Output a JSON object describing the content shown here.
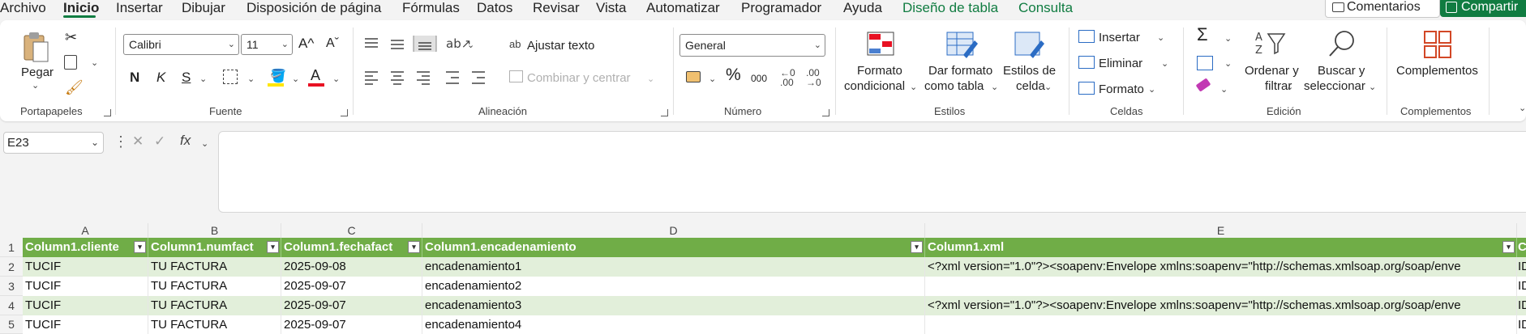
{
  "menu": {
    "items": [
      "Archivo",
      "Inicio",
      "Insertar",
      "Dibujar",
      "Disposición de página",
      "Fórmulas",
      "Datos",
      "Revisar",
      "Vista",
      "Automatizar",
      "Programador",
      "Ayuda",
      "Diseño de tabla",
      "Consulta"
    ],
    "active": "Inicio",
    "comments": "Comentarios",
    "share": "Compartir"
  },
  "ribbon": {
    "portapapeles": {
      "paste": "Pegar",
      "label": "Portapapeles"
    },
    "fuente": {
      "font": "Calibri",
      "size": "11",
      "bold": "N",
      "italic": "K",
      "underline": "S",
      "label": "Fuente"
    },
    "alineacion": {
      "wrap": "Ajustar texto",
      "merge": "Combinar y centrar",
      "label": "Alineación"
    },
    "numero": {
      "format": "General",
      "percent": "%",
      "thousands": "000",
      "label": "Número"
    },
    "estilos": {
      "conditional_1": "Formato",
      "conditional_2": "condicional",
      "astable_1": "Dar formato",
      "astable_2": "como tabla",
      "cellstyles_1": "Estilos de",
      "cellstyles_2": "celda",
      "label": "Estilos"
    },
    "celdas": {
      "insert": "Insertar",
      "delete": "Eliminar",
      "format": "Formato",
      "label": "Celdas"
    },
    "edicion": {
      "sort_1": "Ordenar y",
      "sort_2": "filtrar",
      "find_1": "Buscar y",
      "find_2": "seleccionar",
      "label": "Edición"
    },
    "complementos": {
      "button": "Complementos",
      "label": "Complementos"
    }
  },
  "formula_bar": {
    "name_box": "E23",
    "fx": "fx",
    "value": ""
  },
  "sheet": {
    "column_letters": [
      "A",
      "B",
      "C",
      "D",
      "E"
    ],
    "row_numbers": [
      "1",
      "2",
      "3",
      "4",
      "5"
    ],
    "headers": [
      "Column1.cliente",
      "Column1.numfact",
      "Column1.fechafact",
      "Column1.encadenamiento",
      "Column1.xml"
    ],
    "rows": [
      [
        "TUCIF",
        "TU FACTURA",
        "2025-09-08",
        "encadenamiento1",
        "<?xml version=\"1.0\"?><soapenv:Envelope xmlns:soapenv=\"http://schemas.xmlsoap.org/soap/enve"
      ],
      [
        "TUCIF",
        "TU FACTURA",
        "2025-09-07",
        "encadenamiento2",
        ""
      ],
      [
        "TUCIF",
        "TU FACTURA",
        "2025-09-07",
        "encadenamiento3",
        "<?xml version=\"1.0\"?><soapenv:Envelope xmlns:soapenv=\"http://schemas.xmlsoap.org/soap/enve"
      ],
      [
        "TUCIF",
        "TU FACTURA",
        "2025-09-07",
        "encadenamiento4",
        ""
      ]
    ],
    "partial_column_header": "C",
    "partial_cells": [
      "ID",
      "ID",
      "ID",
      "ID"
    ]
  },
  "colors": {
    "accent": "#107c41",
    "table_header": "#70ad47",
    "band": "#e2efda"
  }
}
